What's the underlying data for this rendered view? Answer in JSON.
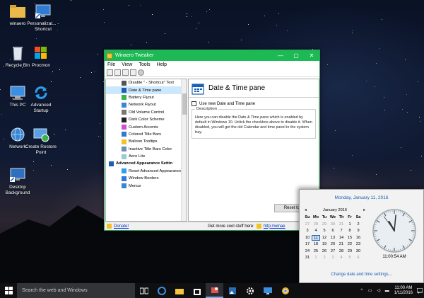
{
  "desktop": {
    "icons": [
      {
        "label": "winaero",
        "icon": "folder-icon"
      },
      {
        "label": "Personalizat... - Shortcut",
        "icon": "personalization-shortcut-icon"
      },
      {
        "label": "Recycle Bin",
        "icon": "recycle-bin-icon"
      },
      {
        "label": "Procmon",
        "icon": "procmon-icon"
      },
      {
        "label": "This PC",
        "icon": "computer-icon"
      },
      {
        "label": "Advanced Startup",
        "icon": "refresh-arrows-icon"
      },
      {
        "label": "Network",
        "icon": "network-globe-icon"
      },
      {
        "label": "Create Restore Point",
        "icon": "restore-point-icon"
      },
      {
        "label": "Desktop Background",
        "icon": "desktop-background-icon"
      }
    ]
  },
  "window": {
    "title": "Winaero Tweaker",
    "minimize": "—",
    "maximize": "▢",
    "close": "✕",
    "menu": [
      "File",
      "View",
      "Tools",
      "Help"
    ],
    "tree": [
      {
        "label": "Disable \" - Shortcut\" Text",
        "type": "item",
        "icon": "shortcut-icon"
      },
      {
        "label": "Date & Time pane",
        "type": "item",
        "selected": true,
        "icon": "calendar-icon"
      },
      {
        "label": "Battery Flyout",
        "type": "item",
        "icon": "battery-icon"
      },
      {
        "label": "Network Flyout",
        "type": "item",
        "icon": "network-icon"
      },
      {
        "label": "Old Volume Control",
        "type": "item",
        "icon": "speaker-icon"
      },
      {
        "label": "Dark Color Scheme",
        "type": "item",
        "icon": "dark-scheme-icon"
      },
      {
        "label": "Custom Accents",
        "type": "item",
        "icon": "palette-icon"
      },
      {
        "label": "Colored Title Bars",
        "type": "item",
        "icon": "titlebar-color-icon"
      },
      {
        "label": "Balloon Tooltips",
        "type": "item",
        "icon": "balloon-icon"
      },
      {
        "label": "Inactive Title Bars Color",
        "type": "item",
        "icon": "titlebar-inactive-icon"
      },
      {
        "label": "Aero Lite",
        "type": "item",
        "icon": "aero-lite-icon"
      },
      {
        "label": "Advanced Appearance Settin",
        "type": "category",
        "icon": "appearance-icon"
      },
      {
        "label": "Reset Advanced Appearance",
        "type": "item",
        "icon": "reset-icon"
      },
      {
        "label": "Window Borders",
        "type": "item",
        "icon": "window-borders-icon"
      },
      {
        "label": "Menus",
        "type": "item",
        "icon": "menus-icon"
      }
    ],
    "panel": {
      "title": "Date & Time pane",
      "checkbox_label": "Use new Date and Time pane",
      "description_title": "Description",
      "description_text": "Here you can disable the Date & Time pane which is enabled by default in Windows 10. Unlick the checkbox above to disable it. When disabled, you will get the old Calendar and time panel in the system tray."
    },
    "reset_button": "Reset to",
    "status": {
      "donate": "Donate!",
      "get_more": "Get more cool stuff here:",
      "link": "http://winae"
    }
  },
  "flyout": {
    "date_long": "Monday, January 11, 2016",
    "month": "January 2016",
    "prev": "◂",
    "next": "▸",
    "weekdays": [
      "Su",
      "Mo",
      "Tu",
      "We",
      "Th",
      "Fr",
      "Sa"
    ],
    "days": [
      {
        "d": "27",
        "other": true
      },
      {
        "d": "28",
        "other": true
      },
      {
        "d": "29",
        "other": true
      },
      {
        "d": "30",
        "other": true
      },
      {
        "d": "31",
        "other": true
      },
      {
        "d": "1"
      },
      {
        "d": "2"
      },
      {
        "d": "3"
      },
      {
        "d": "4"
      },
      {
        "d": "5"
      },
      {
        "d": "6"
      },
      {
        "d": "7"
      },
      {
        "d": "8"
      },
      {
        "d": "9"
      },
      {
        "d": "10"
      },
      {
        "d": "11",
        "today": true
      },
      {
        "d": "12"
      },
      {
        "d": "13"
      },
      {
        "d": "14"
      },
      {
        "d": "15"
      },
      {
        "d": "16"
      },
      {
        "d": "17"
      },
      {
        "d": "18"
      },
      {
        "d": "19"
      },
      {
        "d": "20"
      },
      {
        "d": "21"
      },
      {
        "d": "22"
      },
      {
        "d": "23"
      },
      {
        "d": "24"
      },
      {
        "d": "25"
      },
      {
        "d": "26"
      },
      {
        "d": "27"
      },
      {
        "d": "28"
      },
      {
        "d": "29"
      },
      {
        "d": "30"
      },
      {
        "d": "31"
      },
      {
        "d": "1",
        "other": true
      },
      {
        "d": "2",
        "other": true
      },
      {
        "d": "3",
        "other": true
      },
      {
        "d": "4",
        "other": true
      },
      {
        "d": "5",
        "other": true
      },
      {
        "d": "6",
        "other": true
      }
    ],
    "clock_time": "11:00:54 AM",
    "clock_value": {
      "hour": 11,
      "minute": 0,
      "second": 54
    },
    "change_link": "Change date and time settings..."
  },
  "taskbar": {
    "search_placeholder": "Search the web and Windows",
    "pinned": [
      "task-view-icon",
      "edge-icon",
      "file-explorer-icon",
      "store-icon",
      "winaero-tweaker-icon",
      "photos-icon",
      "settings-gear-icon",
      "remote-desktop-icon",
      "chrome-icon"
    ],
    "time": "11:00 AM",
    "date": "1/11/2016"
  },
  "colors": {
    "titlebar": "#1db954",
    "accent_blue": "#1a5fb4",
    "taskbar": "#0f0f12"
  }
}
